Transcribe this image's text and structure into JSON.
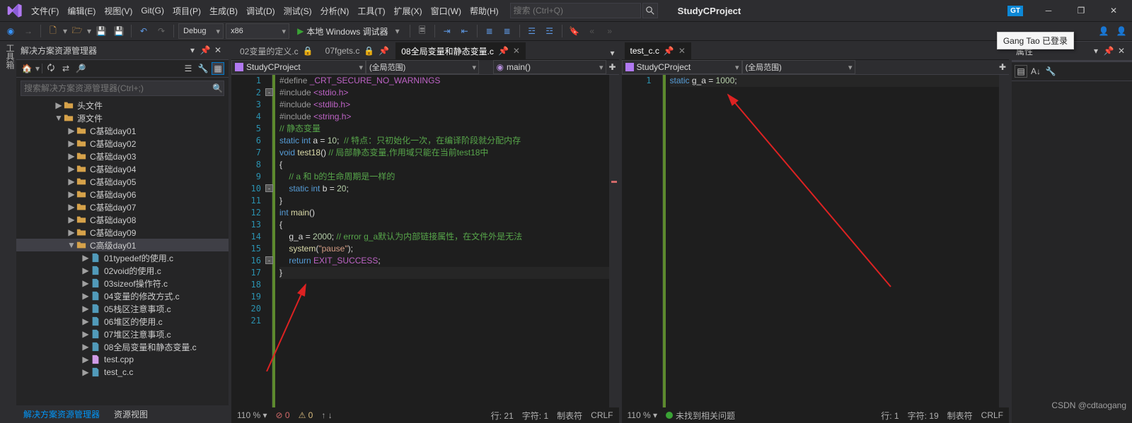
{
  "menu": {
    "items": [
      "文件(F)",
      "编辑(E)",
      "视图(V)",
      "Git(G)",
      "项目(P)",
      "生成(B)",
      "调试(D)",
      "测试(S)",
      "分析(N)",
      "工具(T)",
      "扩展(X)",
      "窗口(W)",
      "帮助(H)"
    ]
  },
  "title": {
    "app": "StudyCProject"
  },
  "search": {
    "placeholder": "搜索 (Ctrl+Q)"
  },
  "user": {
    "initials": "GT",
    "tooltip": "Gang Tao 已登录"
  },
  "toolbar": {
    "config": "Debug",
    "platform": "x86",
    "run": "本地 Windows 调试器"
  },
  "vbar": {
    "label": "工具箱"
  },
  "solution": {
    "title": "解决方案资源管理器",
    "search_placeholder": "搜索解决方案资源管理器(Ctrl+;)",
    "tree": [
      {
        "indent": 54,
        "arrow": "▶",
        "type": "folder",
        "label": "头文件"
      },
      {
        "indent": 54,
        "arrow": "▼",
        "type": "folder",
        "label": "源文件"
      },
      {
        "indent": 72,
        "arrow": "▶",
        "type": "folder",
        "label": "C基础day01"
      },
      {
        "indent": 72,
        "arrow": "▶",
        "type": "folder",
        "label": "C基础day02"
      },
      {
        "indent": 72,
        "arrow": "▶",
        "type": "folder",
        "label": "C基础day03"
      },
      {
        "indent": 72,
        "arrow": "▶",
        "type": "folder",
        "label": "C基础day04"
      },
      {
        "indent": 72,
        "arrow": "▶",
        "type": "folder",
        "label": "C基础day05"
      },
      {
        "indent": 72,
        "arrow": "▶",
        "type": "folder",
        "label": "C基础day06"
      },
      {
        "indent": 72,
        "arrow": "▶",
        "type": "folder",
        "label": "C基础day07"
      },
      {
        "indent": 72,
        "arrow": "▶",
        "type": "folder",
        "label": "C基础day08"
      },
      {
        "indent": 72,
        "arrow": "▶",
        "type": "folder",
        "label": "C基础day09"
      },
      {
        "indent": 72,
        "arrow": "▼",
        "type": "folder",
        "label": "C高级day01",
        "selected": true
      },
      {
        "indent": 92,
        "arrow": "▶",
        "type": "c",
        "label": "01typedef的使用.c"
      },
      {
        "indent": 92,
        "arrow": "▶",
        "type": "c",
        "label": "02void的使用.c"
      },
      {
        "indent": 92,
        "arrow": "▶",
        "type": "c",
        "label": "03sizeof操作符.c"
      },
      {
        "indent": 92,
        "arrow": "▶",
        "type": "c",
        "label": "04变量的修改方式.c"
      },
      {
        "indent": 92,
        "arrow": "▶",
        "type": "c",
        "label": "05栈区注意事项.c"
      },
      {
        "indent": 92,
        "arrow": "▶",
        "type": "c",
        "label": "06堆区的使用.c"
      },
      {
        "indent": 92,
        "arrow": "▶",
        "type": "c",
        "label": "07堆区注意事项.c"
      },
      {
        "indent": 92,
        "arrow": "▶",
        "type": "c",
        "label": "08全局变量和静态变量.c"
      },
      {
        "indent": 92,
        "arrow": "▶",
        "type": "cpp",
        "label": "test.cpp"
      },
      {
        "indent": 92,
        "arrow": "▶",
        "type": "c",
        "label": "test_c.c"
      }
    ],
    "bottom_tabs": {
      "a": "解决方案资源管理器",
      "b": "资源视图"
    }
  },
  "editor_left": {
    "tabs": [
      {
        "label": "02变量的定义.c",
        "active": false,
        "lock": true
      },
      {
        "label": "07fgets.c",
        "active": false,
        "lock": true,
        "pin": true
      },
      {
        "label": "08全局变量和静态变量.c",
        "active": true,
        "pin": true,
        "closable": true
      }
    ],
    "nav": {
      "project": "StudyCProject",
      "scope": "(全局范围)",
      "member": "main()"
    },
    "lines": [
      "1",
      "2",
      "3",
      "4",
      "5",
      "6",
      "7",
      "8",
      "9",
      "10",
      "11",
      "12",
      "13",
      "14",
      "15",
      "16",
      "17",
      "18",
      "19",
      "20",
      "21"
    ],
    "code": [
      {
        "t": "#define ",
        "c": "pp",
        "a": "_CRT_SECURE_NO_WARNINGS",
        "ac": "macro"
      },
      {
        "raw": "<span class='pp'>#include </span><span class='macro'>&lt;stdio.h&gt;</span>",
        "fold": "-"
      },
      {
        "raw": "<span class='pp'>#include </span><span class='macro'>&lt;stdlib.h&gt;</span>"
      },
      {
        "raw": "<span class='pp'>#include </span><span class='macro'>&lt;string.h&gt;</span>"
      },
      {
        "raw": ""
      },
      {
        "raw": ""
      },
      {
        "raw": "<span class='cm'>// 静态变量</span>"
      },
      {
        "raw": "<span class='kw'>static</span> <span class='kw'>int</span> a = <span class='num'>10</span>;  <span class='cm'>// 特点：只初始化一次，在编译阶段就分配内存</span>"
      },
      {
        "raw": ""
      },
      {
        "raw": "<span class='kw'>void</span> <span class='fn'>test18</span>() <span class='cm'>// 局部静态变量,作用域只能在当前test18中</span>",
        "fold": "-"
      },
      {
        "raw": "{"
      },
      {
        "raw": "    <span class='cm'>// a 和 b的生命周期是一样的</span>"
      },
      {
        "raw": "    <span class='kw'>static</span> <span class='kw'>int</span> b = <span class='num'>20</span>;"
      },
      {
        "raw": "}"
      },
      {
        "raw": ""
      },
      {
        "raw": "<span class='kw'>int</span> <span class='fn'>main</span>()",
        "fold": "-"
      },
      {
        "raw": "{"
      },
      {
        "raw": "    g_a = <span class='num'>2000</span>; <span class='cm'>// error g_a默认为内部链接属性，在文件外是无法</span>"
      },
      {
        "raw": "    <span class='lib'>system</span>(<span class='str'>\"pause\"</span>);"
      },
      {
        "raw": "    <span class='kw'>return</span> <span class='macro'>EXIT_SUCCESS</span>;"
      },
      {
        "raw": "}",
        "cursor": true
      }
    ],
    "status": {
      "zoom": "110 %",
      "err": "0",
      "warn": "0",
      "line": "行: 21",
      "col": "字符: 1",
      "tab": "制表符",
      "eol": "CRLF"
    }
  },
  "editor_right": {
    "tab": {
      "label": "test_c.c",
      "closable": true
    },
    "nav": {
      "project": "StudyCProject",
      "scope": "(全局范围)"
    },
    "lines": [
      "1"
    ],
    "code": [
      {
        "raw": "<span class='kw'>static</span> g_a = <span class='num'>1000</span>;",
        "cursor": true
      }
    ],
    "status": {
      "zoom": "110 %",
      "issues": "未找到相关问题",
      "line": "行: 1",
      "col": "字符: 19",
      "tab": "制表符",
      "eol": "CRLF"
    }
  },
  "props": {
    "title": "属性"
  },
  "watermark": "CSDN @cdtaogang"
}
